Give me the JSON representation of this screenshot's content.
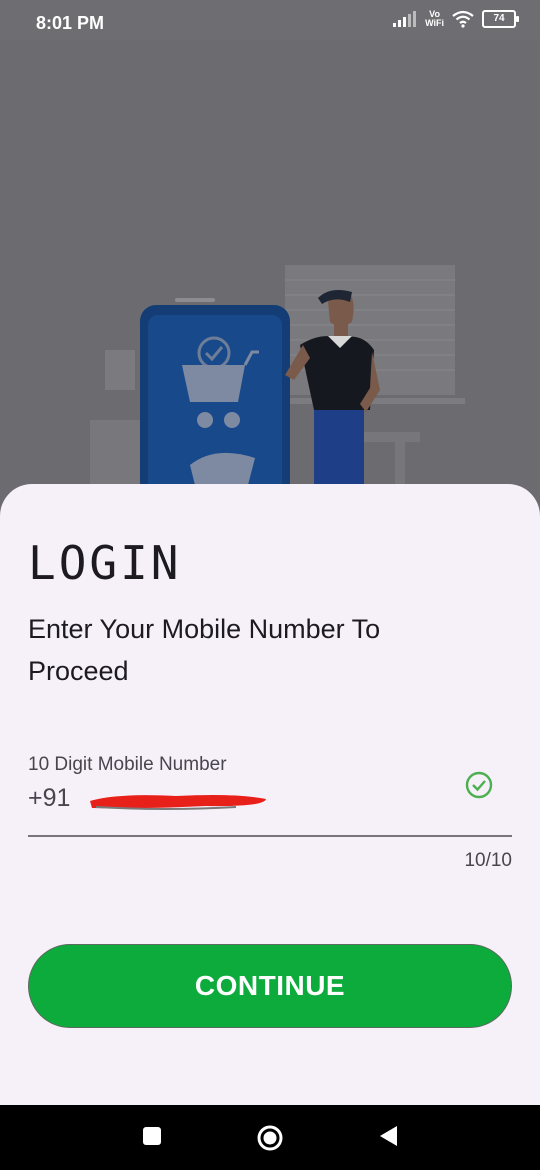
{
  "status_bar": {
    "time": "8:01 PM",
    "network_label_top": "Vo",
    "network_label_bottom": "WiFi",
    "battery": "74"
  },
  "login": {
    "title": "LOGIN",
    "subtitle": "Enter Your Mobile Number To Proceed",
    "phone_field": {
      "label": "10 Digit Mobile Number",
      "prefix": "+91",
      "counter": "10/10"
    },
    "continue_label": "CONTINUE"
  },
  "colors": {
    "accent_green": "#0cab3c",
    "check_green": "#4caf50",
    "sheet_background": "#f6f1f9"
  },
  "icons": {
    "field_status": "check-circle-icon",
    "nav_recents": "square-icon",
    "nav_home": "circle-icon",
    "nav_back": "triangle-back-icon"
  }
}
